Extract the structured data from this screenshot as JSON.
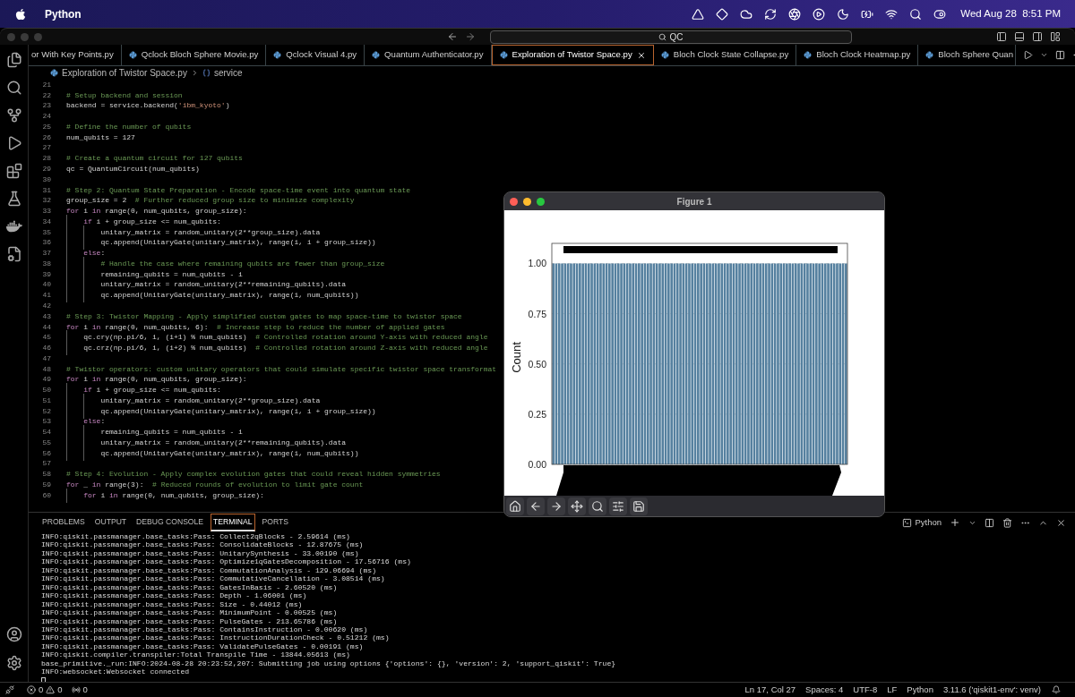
{
  "menu_bar": {
    "app": "Python",
    "clock": "Wed Aug 28  8:51 PM"
  },
  "title_bar": {
    "search": {
      "value": "QC"
    }
  },
  "tabs": [
    {
      "label": "or With Key Points.py",
      "selected": false
    },
    {
      "label": "Qclock Bloch Sphere Movie.py",
      "selected": false
    },
    {
      "label": "Qclock Visual 4.py",
      "selected": false
    },
    {
      "label": "Quantum Authenticator.py",
      "selected": false
    },
    {
      "label": "Exploration of Twistor Space.py",
      "selected": true
    },
    {
      "label": "Bloch Clock State Collapse.py",
      "selected": false
    },
    {
      "label": "Bloch Clock Heatmap.py",
      "selected": false
    },
    {
      "label": "Bloch Sphere Quan",
      "selected": false
    }
  ],
  "breadcrumb": [
    "Exploration of Twistor Space.py",
    "service"
  ],
  "code_lines": [
    {
      "number": "21"
    },
    {
      "number": "22",
      "segments": [
        {
          "text": "# Setup backend and session",
          "kind": "comment"
        }
      ]
    },
    {
      "number": "23",
      "segments": [
        {
          "text": "backend = service.backend(",
          "kind": "code"
        },
        {
          "text": "'ibm_kyoto'",
          "kind": "string"
        },
        {
          "text": ")",
          "kind": "code"
        }
      ]
    },
    {
      "number": "24"
    },
    {
      "number": "25",
      "segments": [
        {
          "text": "# Define the number of qubits",
          "kind": "comment"
        }
      ]
    },
    {
      "number": "26",
      "segments": [
        {
          "text": "num_qubits = 127",
          "kind": "code"
        }
      ]
    },
    {
      "number": "27"
    },
    {
      "number": "28",
      "segments": [
        {
          "text": "# Create a quantum circuit for 127 qubits",
          "kind": "comment"
        }
      ]
    },
    {
      "number": "29",
      "segments": [
        {
          "text": "qc = QuantumCircuit(num_qubits)",
          "kind": "code"
        }
      ]
    },
    {
      "number": "30"
    },
    {
      "number": "31",
      "segments": [
        {
          "text": "# Step 2: Quantum State Preparation - Encode space-time event into quantum state",
          "kind": "comment"
        }
      ]
    },
    {
      "number": "32",
      "segments": [
        {
          "text": "group_size = 2  ",
          "kind": "code"
        },
        {
          "text": "# Further reduced group size to minimize complexity",
          "kind": "comment"
        }
      ]
    },
    {
      "number": "33",
      "segments": [
        {
          "text": "for",
          "kind": "keyword"
        },
        {
          "text": " i ",
          "kind": "code"
        },
        {
          "text": "in",
          "kind": "keyword"
        },
        {
          "text": " range(0, num_qubits, group_size):",
          "kind": "code"
        }
      ]
    },
    {
      "number": "34",
      "segments": [
        {
          "text": "    if",
          "kind": "keyword"
        },
        {
          "text": " i + group_size <= num_qubits:",
          "kind": "code"
        }
      ]
    },
    {
      "number": "35",
      "segments": [
        {
          "text": "        unitary_matrix = random_unitary(2**group_size).data",
          "kind": "code"
        }
      ]
    },
    {
      "number": "36",
      "segments": [
        {
          "text": "        qc.append(UnitaryGate(unitary_matrix), range(i, i + group_size))",
          "kind": "code"
        }
      ]
    },
    {
      "number": "37",
      "segments": [
        {
          "text": "    else",
          "kind": "keyword"
        },
        {
          "text": ":",
          "kind": "code"
        }
      ]
    },
    {
      "number": "38",
      "segments": [
        {
          "text": "        # Handle the case where remaining qubits are fewer than group_size",
          "kind": "comment"
        }
      ]
    },
    {
      "number": "39",
      "segments": [
        {
          "text": "        remaining_qubits = num_qubits - i",
          "kind": "code"
        }
      ]
    },
    {
      "number": "40",
      "segments": [
        {
          "text": "        unitary_matrix = random_unitary(2**remaining_qubits).data",
          "kind": "code"
        }
      ]
    },
    {
      "number": "41",
      "segments": [
        {
          "text": "        qc.append(UnitaryGate(unitary_matrix), range(i, num_qubits))",
          "kind": "code"
        }
      ]
    },
    {
      "number": "42"
    },
    {
      "number": "43",
      "segments": [
        {
          "text": "# Step 3: Twistor Mapping - Apply simplified custom gates to map space-time to twistor space",
          "kind": "comment"
        }
      ]
    },
    {
      "number": "44",
      "segments": [
        {
          "text": "for",
          "kind": "keyword"
        },
        {
          "text": " i ",
          "kind": "code"
        },
        {
          "text": "in",
          "kind": "keyword"
        },
        {
          "text": " range(0, num_qubits, 6):  ",
          "kind": "code"
        },
        {
          "text": "# Increase step to reduce the number of applied gates",
          "kind": "comment"
        }
      ]
    },
    {
      "number": "45",
      "segments": [
        {
          "text": "    qc.cry(np.pi/6, i, (i+1) % num_qubits)  ",
          "kind": "code"
        },
        {
          "text": "# Controlled rotation around Y-axis with reduced angle",
          "kind": "comment"
        }
      ]
    },
    {
      "number": "46",
      "segments": [
        {
          "text": "    qc.crz(np.pi/6, i, (i+2) % num_qubits)  ",
          "kind": "code"
        },
        {
          "text": "# Controlled rotation around Z-axis with reduced angle",
          "kind": "comment"
        }
      ]
    },
    {
      "number": "47"
    },
    {
      "number": "48",
      "segments": [
        {
          "text": "# Twistor operators: custom unitary operators that could simulate specific twistor space transformat",
          "kind": "comment"
        }
      ]
    },
    {
      "number": "49",
      "segments": [
        {
          "text": "for",
          "kind": "keyword"
        },
        {
          "text": " i ",
          "kind": "code"
        },
        {
          "text": "in",
          "kind": "keyword"
        },
        {
          "text": " range(0, num_qubits, group_size):",
          "kind": "code"
        }
      ]
    },
    {
      "number": "50",
      "segments": [
        {
          "text": "    if",
          "kind": "keyword"
        },
        {
          "text": " i + group_size <= num_qubits:",
          "kind": "code"
        }
      ]
    },
    {
      "number": "51",
      "segments": [
        {
          "text": "        unitary_matrix = random_unitary(2**group_size).data",
          "kind": "code"
        }
      ]
    },
    {
      "number": "52",
      "segments": [
        {
          "text": "        qc.append(UnitaryGate(unitary_matrix), range(i, i + group_size))",
          "kind": "code"
        }
      ]
    },
    {
      "number": "53",
      "segments": [
        {
          "text": "    else",
          "kind": "keyword"
        },
        {
          "text": ":",
          "kind": "code"
        }
      ]
    },
    {
      "number": "54",
      "segments": [
        {
          "text": "        remaining_qubits = num_qubits - i",
          "kind": "code"
        }
      ]
    },
    {
      "number": "55",
      "segments": [
        {
          "text": "        unitary_matrix = random_unitary(2**remaining_qubits).data",
          "kind": "code"
        }
      ]
    },
    {
      "number": "56",
      "segments": [
        {
          "text": "        qc.append(UnitaryGate(unitary_matrix), range(i, num_qubits))",
          "kind": "code"
        }
      ]
    },
    {
      "number": "57"
    },
    {
      "number": "58",
      "segments": [
        {
          "text": "# Step 4: Evolution - Apply complex evolution gates that could reveal hidden symmetries",
          "kind": "comment"
        }
      ]
    },
    {
      "number": "59",
      "segments": [
        {
          "text": "for",
          "kind": "keyword"
        },
        {
          "text": " _ ",
          "kind": "code"
        },
        {
          "text": "in",
          "kind": "keyword"
        },
        {
          "text": " range(3):  ",
          "kind": "code"
        },
        {
          "text": "# Reduced rounds of evolution to limit gate count",
          "kind": "comment"
        }
      ]
    },
    {
      "number": "60",
      "segments": [
        {
          "text": "    for",
          "kind": "keyword"
        },
        {
          "text": " i ",
          "kind": "code"
        },
        {
          "text": "in",
          "kind": "keyword"
        },
        {
          "text": " range(0, num_qubits, group_size):",
          "kind": "code"
        }
      ]
    }
  ],
  "figure": {
    "title": "Figure 1",
    "chart_data": {
      "type": "bar",
      "ylabel": "Count",
      "grid": true,
      "ylim": [
        0,
        1.1
      ],
      "yticks": [
        {
          "value": 0,
          "label": "0.00"
        },
        {
          "value": 0.25,
          "label": "0.25"
        },
        {
          "value": 0.5,
          "label": "0.50"
        },
        {
          "value": 0.75,
          "label": "0.75"
        },
        {
          "value": 1,
          "label": "1.00"
        }
      ],
      "values": [
        1,
        1,
        1,
        1,
        1,
        1,
        1,
        1,
        1,
        1,
        1,
        1,
        1,
        1,
        1,
        1,
        1,
        1,
        1,
        1,
        1,
        1,
        1,
        1,
        1,
        1,
        1,
        1,
        1,
        1,
        1,
        1,
        1,
        1,
        1,
        1,
        1,
        1,
        1,
        1,
        1,
        1,
        1,
        1,
        1,
        1,
        1,
        1,
        1,
        1,
        1,
        1,
        1,
        1,
        1,
        1,
        1,
        1,
        1,
        1,
        1,
        1,
        1,
        1,
        1,
        1,
        1,
        1,
        1,
        1,
        1,
        1,
        1,
        1,
        1,
        1,
        1,
        1,
        1,
        1,
        1,
        1,
        1,
        1,
        1,
        1,
        1,
        1,
        1,
        1,
        1,
        1,
        1,
        1,
        1,
        1,
        1,
        1,
        1,
        1
      ]
    }
  },
  "panel": {
    "tabs": [
      {
        "label": "PROBLEMS",
        "selected": false
      },
      {
        "label": "OUTPUT",
        "selected": false
      },
      {
        "label": "DEBUG CONSOLE",
        "selected": false
      },
      {
        "label": "TERMINAL",
        "selected": true
      },
      {
        "label": "PORTS",
        "selected": false
      }
    ],
    "terminal_label": "Python",
    "lines": [
      "INFO:qiskit.passmanager.base_tasks:Pass: Collect2qBlocks - 2.59614 (ms)",
      "INFO:qiskit.passmanager.base_tasks:Pass: ConsolidateBlocks - 12.87675 (ms)",
      "INFO:qiskit.passmanager.base_tasks:Pass: UnitarySynthesis - 33.00190 (ms)",
      "INFO:qiskit.passmanager.base_tasks:Pass: Optimize1qGatesDecomposition - 17.56716 (ms)",
      "INFO:qiskit.passmanager.base_tasks:Pass: CommutationAnalysis - 129.06694 (ms)",
      "INFO:qiskit.passmanager.base_tasks:Pass: CommutativeCancellation - 3.08514 (ms)",
      "INFO:qiskit.passmanager.base_tasks:Pass: GatesInBasis - 2.60520 (ms)",
      "INFO:qiskit.passmanager.base_tasks:Pass: Depth - 1.06001 (ms)",
      "INFO:qiskit.passmanager.base_tasks:Pass: Size - 0.44012 (ms)",
      "INFO:qiskit.passmanager.base_tasks:Pass: MinimumPoint - 0.00525 (ms)",
      "INFO:qiskit.passmanager.base_tasks:Pass: PulseGates - 213.65786 (ms)",
      "INFO:qiskit.passmanager.base_tasks:Pass: ContainsInstruction - 0.00620 (ms)",
      "INFO:qiskit.passmanager.base_tasks:Pass: InstructionDurationCheck - 0.51212 (ms)",
      "INFO:qiskit.passmanager.base_tasks:Pass: ValidatePulseGates - 0.00191 (ms)",
      "INFO:qiskit.compiler.transpiler:Total Transpile Time - 13844.05613 (ms)",
      "base_primitive._run:INFO:2024-08-28 20:23:52,207: Submitting job using options {'options': {}, 'version': 2, 'support_qiskit': True}",
      "INFO:websocket:Websocket connected"
    ]
  },
  "status_bar": {
    "errors": "0",
    "warnings": "0",
    "ports": "0",
    "items": [
      "Ln 17, Col 27",
      "Spaces: 4",
      "UTF-8",
      "LF",
      "Python",
      "3.11.6 ('qiskit1-env': venv)"
    ]
  }
}
